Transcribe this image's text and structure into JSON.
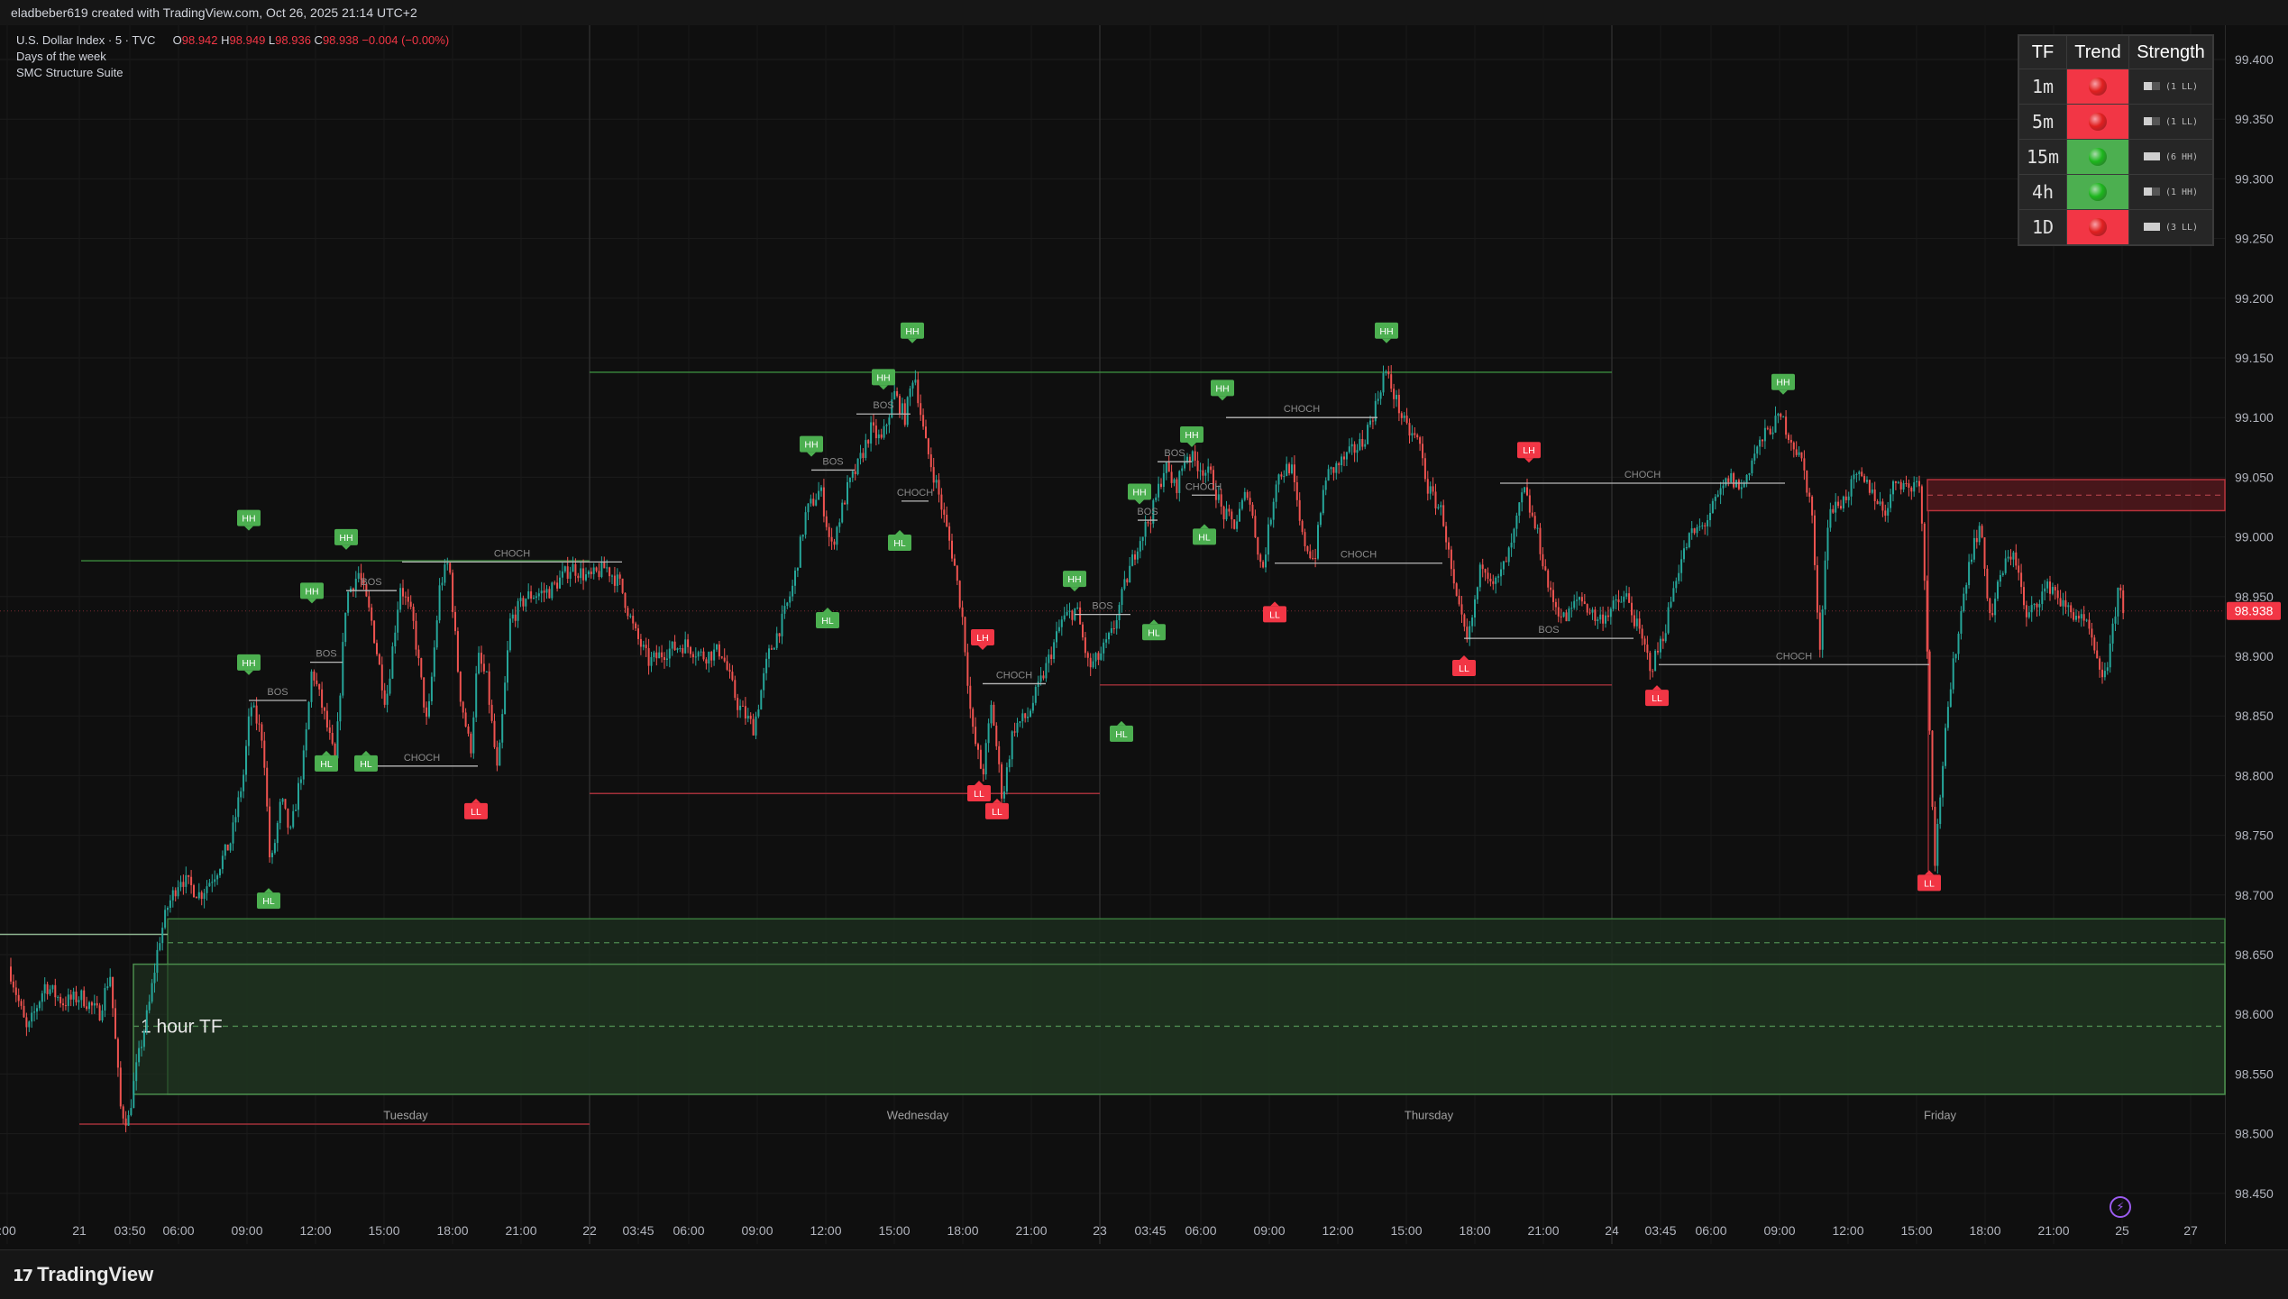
{
  "header": {
    "caption": "eladbeber619 created with TradingView.com, Oct 26, 2025 21:14 UTC+2"
  },
  "legend": {
    "symbol": "U.S. Dollar Index · 5 · TVC",
    "ohlc": {
      "o_label": "O",
      "o": "98.942",
      "h_label": "H",
      "h": "98.949",
      "l_label": "L",
      "l": "98.936",
      "c_label": "C",
      "c": "98.938",
      "change": "−0.004 (−0.00%)"
    },
    "indicators": [
      "Days of the week",
      "SMC Structure Suite"
    ]
  },
  "tf_table": {
    "headers": [
      "TF",
      "Trend",
      "Strength"
    ],
    "rows": [
      {
        "tf": "1m",
        "trend": "bearish",
        "strength": "(1 LL)"
      },
      {
        "tf": "5m",
        "trend": "bearish",
        "strength": "(1 LL)"
      },
      {
        "tf": "15m",
        "trend": "bullish",
        "strength": "(6 HH)"
      },
      {
        "tf": "4h",
        "trend": "bullish",
        "strength": "(1 HH)"
      },
      {
        "tf": "1D",
        "trend": "bearish",
        "strength": "(3 LL)"
      }
    ]
  },
  "colors": {
    "bull": "#26a69a",
    "bear": "#ef5350",
    "label_green": "#4caf50",
    "label_red": "#f23645",
    "zone_fill": "#1b2c1d",
    "supply_fill": "#5b1a1f",
    "trend_green_cell": "#4caf50",
    "trend_red_cell": "#f23645"
  },
  "chart_data": {
    "type": "candlestick",
    "symbol": "U.S. Dollar Index",
    "timeframe": "5",
    "ylim": [
      98.42,
      99.43
    ],
    "price_ticks": [
      "99.400",
      "99.350",
      "99.300",
      "99.250",
      "99.200",
      "99.150",
      "99.100",
      "99.050",
      "99.000",
      "98.950",
      "98.900",
      "98.850",
      "98.800",
      "98.750",
      "98.700",
      "98.650",
      "98.600",
      "98.550",
      "98.500",
      "98.450"
    ],
    "last_price": "98.938",
    "time_ticks": [
      ":00",
      "21",
      "03:50",
      "06:00",
      "09:00",
      "12:00",
      "15:00",
      "18:00",
      "21:00",
      "22",
      "03:45",
      "06:00",
      "09:00",
      "12:00",
      "15:00",
      "18:00",
      "21:00",
      "23",
      "03:45",
      "06:00",
      "09:00",
      "12:00",
      "15:00",
      "18:00",
      "21:00",
      "24",
      "03:45",
      "06:00",
      "09:00",
      "12:00",
      "15:00",
      "18:00",
      "21:00",
      "25",
      "27"
    ],
    "day_labels": [
      "Tuesday",
      "Wednesday",
      "Thursday",
      "Friday"
    ],
    "zone_label": "1 hour TF",
    "demand_zone": {
      "outer_top": 98.68,
      "outer_bottom": 98.533,
      "inner_top": 98.642,
      "mid_upper": 98.66,
      "mid_lower": 98.59
    },
    "supply_zone": {
      "top": 99.048,
      "bottom": 99.022,
      "mid": 99.035
    },
    "structure_labels": [
      {
        "text": "HH",
        "type": "high",
        "price": 99.14,
        "time": "Wed 15:00"
      },
      {
        "text": "HH",
        "type": "high",
        "price": 99.14,
        "time": "Thu 14:00"
      },
      {
        "text": "HH",
        "type": "high",
        "price": 99.1,
        "time": "Fri 09:00"
      },
      {
        "text": "LH",
        "type": "high",
        "price": 99.05,
        "time": "Thu 20:00"
      },
      {
        "text": "LL",
        "type": "low",
        "price": 98.72,
        "time": "Fri 15:00"
      },
      {
        "text": "LL",
        "type": "low",
        "price": 98.785,
        "time": "Wed 20:00"
      },
      {
        "text": "LL",
        "type": "low",
        "price": 98.795,
        "time": "Tue 18:30"
      },
      {
        "text": "HL",
        "type": "low",
        "price": 98.7,
        "time": "Tue 08:00"
      }
    ],
    "structure_tags": [
      "BOS",
      "CHOCH"
    ]
  }
}
